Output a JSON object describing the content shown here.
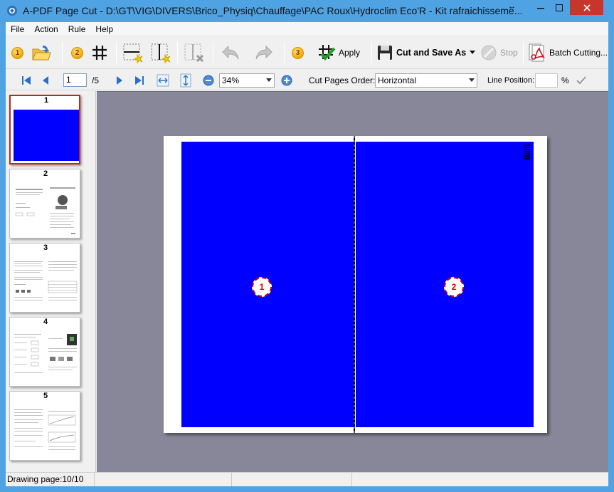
{
  "window": {
    "title": "A-PDF Page Cut - D:\\GT\\VIG\\DIVERS\\Brico_Physiq\\Chauffage\\PAC Roux\\Hydroclim Eco'R - Kit rafraichisseme...",
    "title_extra": "↔"
  },
  "menu": [
    "File",
    "Action",
    "Rule",
    "Help"
  ],
  "toolbar": {
    "step1": "1",
    "step2": "2",
    "step3": "3",
    "apply_label": "Apply",
    "cut_save_label": "Cut and Save As",
    "stop_label": "Stop",
    "batch_label": "Batch Cutting..."
  },
  "nav": {
    "current_page": "1",
    "total_pages": "/5",
    "zoom": "34%",
    "cut_order_label": "Cut Pages Order:",
    "cut_order_value": "Horizontal",
    "line_position_label": "Line Position:",
    "line_position_value": "",
    "percent": "%"
  },
  "thumbnails": [
    {
      "num": "1"
    },
    {
      "num": "2"
    },
    {
      "num": "3"
    },
    {
      "num": "4"
    },
    {
      "num": "5"
    }
  ],
  "canvas": {
    "region1": "1",
    "region2": "2"
  },
  "colors": {
    "page_fill": "#0000ff",
    "accent": "#4fa3e3",
    "close": "#c7352b",
    "badge": "#d40000"
  },
  "status": {
    "text": "Drawing page:10/10"
  }
}
